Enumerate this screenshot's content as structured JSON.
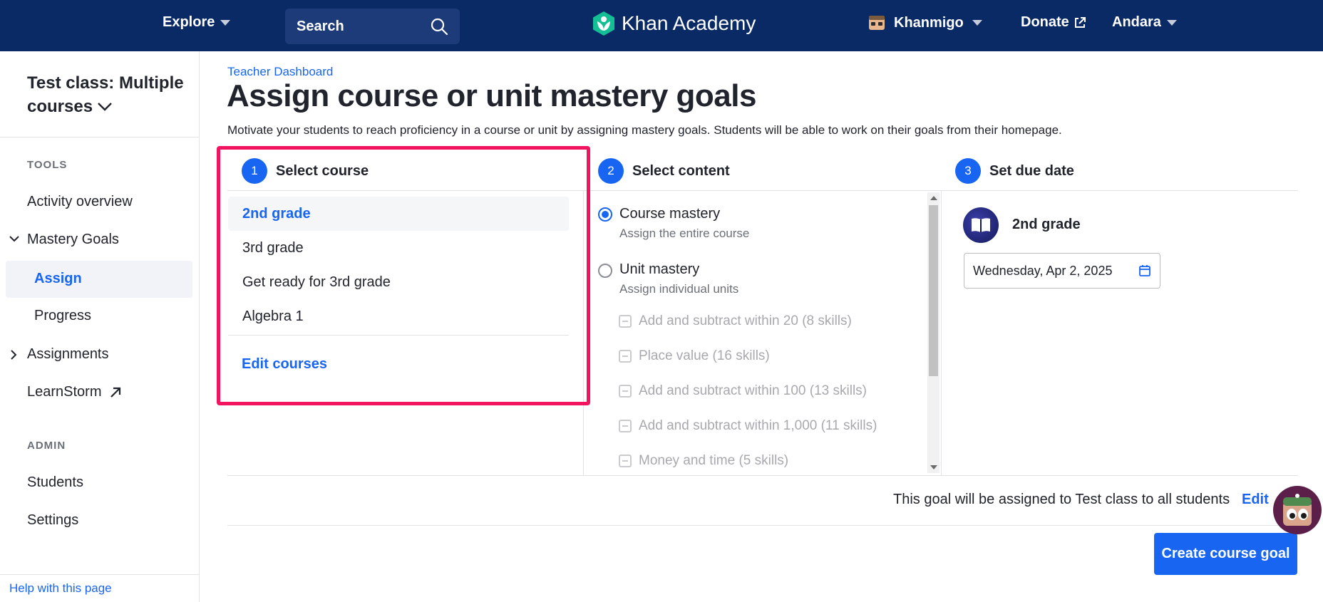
{
  "nav": {
    "explore": "Explore",
    "search_label": "Search",
    "logo_text": "Khan Academy",
    "khanmigo": "Khanmigo",
    "donate": "Donate",
    "user": "Andara"
  },
  "sidebar": {
    "class_title_line1": "Test class: Multiple",
    "class_title_line2": "courses",
    "tools_label": "TOOLS",
    "activity_overview": "Activity overview",
    "mastery_goals": "Mastery Goals",
    "assign": "Assign",
    "progress": "Progress",
    "assignments": "Assignments",
    "learnstorm": "LearnStorm",
    "admin_label": "ADMIN",
    "students": "Students",
    "settings": "Settings",
    "help": "Help with this page"
  },
  "main": {
    "breadcrumb": "Teacher Dashboard",
    "title": "Assign course or unit mastery goals",
    "description": "Motivate your students to reach proficiency in a course or unit by assigning mastery goals. Students will be able to work on their goals from their homepage."
  },
  "steps": [
    {
      "num": "1",
      "label": "Select course"
    },
    {
      "num": "2",
      "label": "Select content"
    },
    {
      "num": "3",
      "label": "Set due date"
    }
  ],
  "courses": [
    "2nd grade",
    "3rd grade",
    "Get ready for 3rd grade",
    "Algebra 1"
  ],
  "selected_course": "2nd grade",
  "edit_courses": "Edit courses",
  "content_options": {
    "course_mastery": {
      "title": "Course mastery",
      "sub": "Assign the entire course"
    },
    "unit_mastery": {
      "title": "Unit mastery",
      "sub": "Assign individual units"
    }
  },
  "units": [
    "Add and subtract within 20 (8 skills)",
    "Place value (16 skills)",
    "Add and subtract within 100 (13 skills)",
    "Add and subtract within 1,000 (11 skills)",
    "Money and time (5 skills)"
  ],
  "due": {
    "course": "2nd grade",
    "date": "Wednesday, Apr 2, 2025"
  },
  "summary": {
    "text": "This goal will be assigned to Test class to all students",
    "edit": "Edit"
  },
  "create_button": "Create course goal",
  "colors": {
    "nav_bg": "#0a2a66",
    "accent": "#1865f2",
    "highlight": "#f2145e"
  }
}
